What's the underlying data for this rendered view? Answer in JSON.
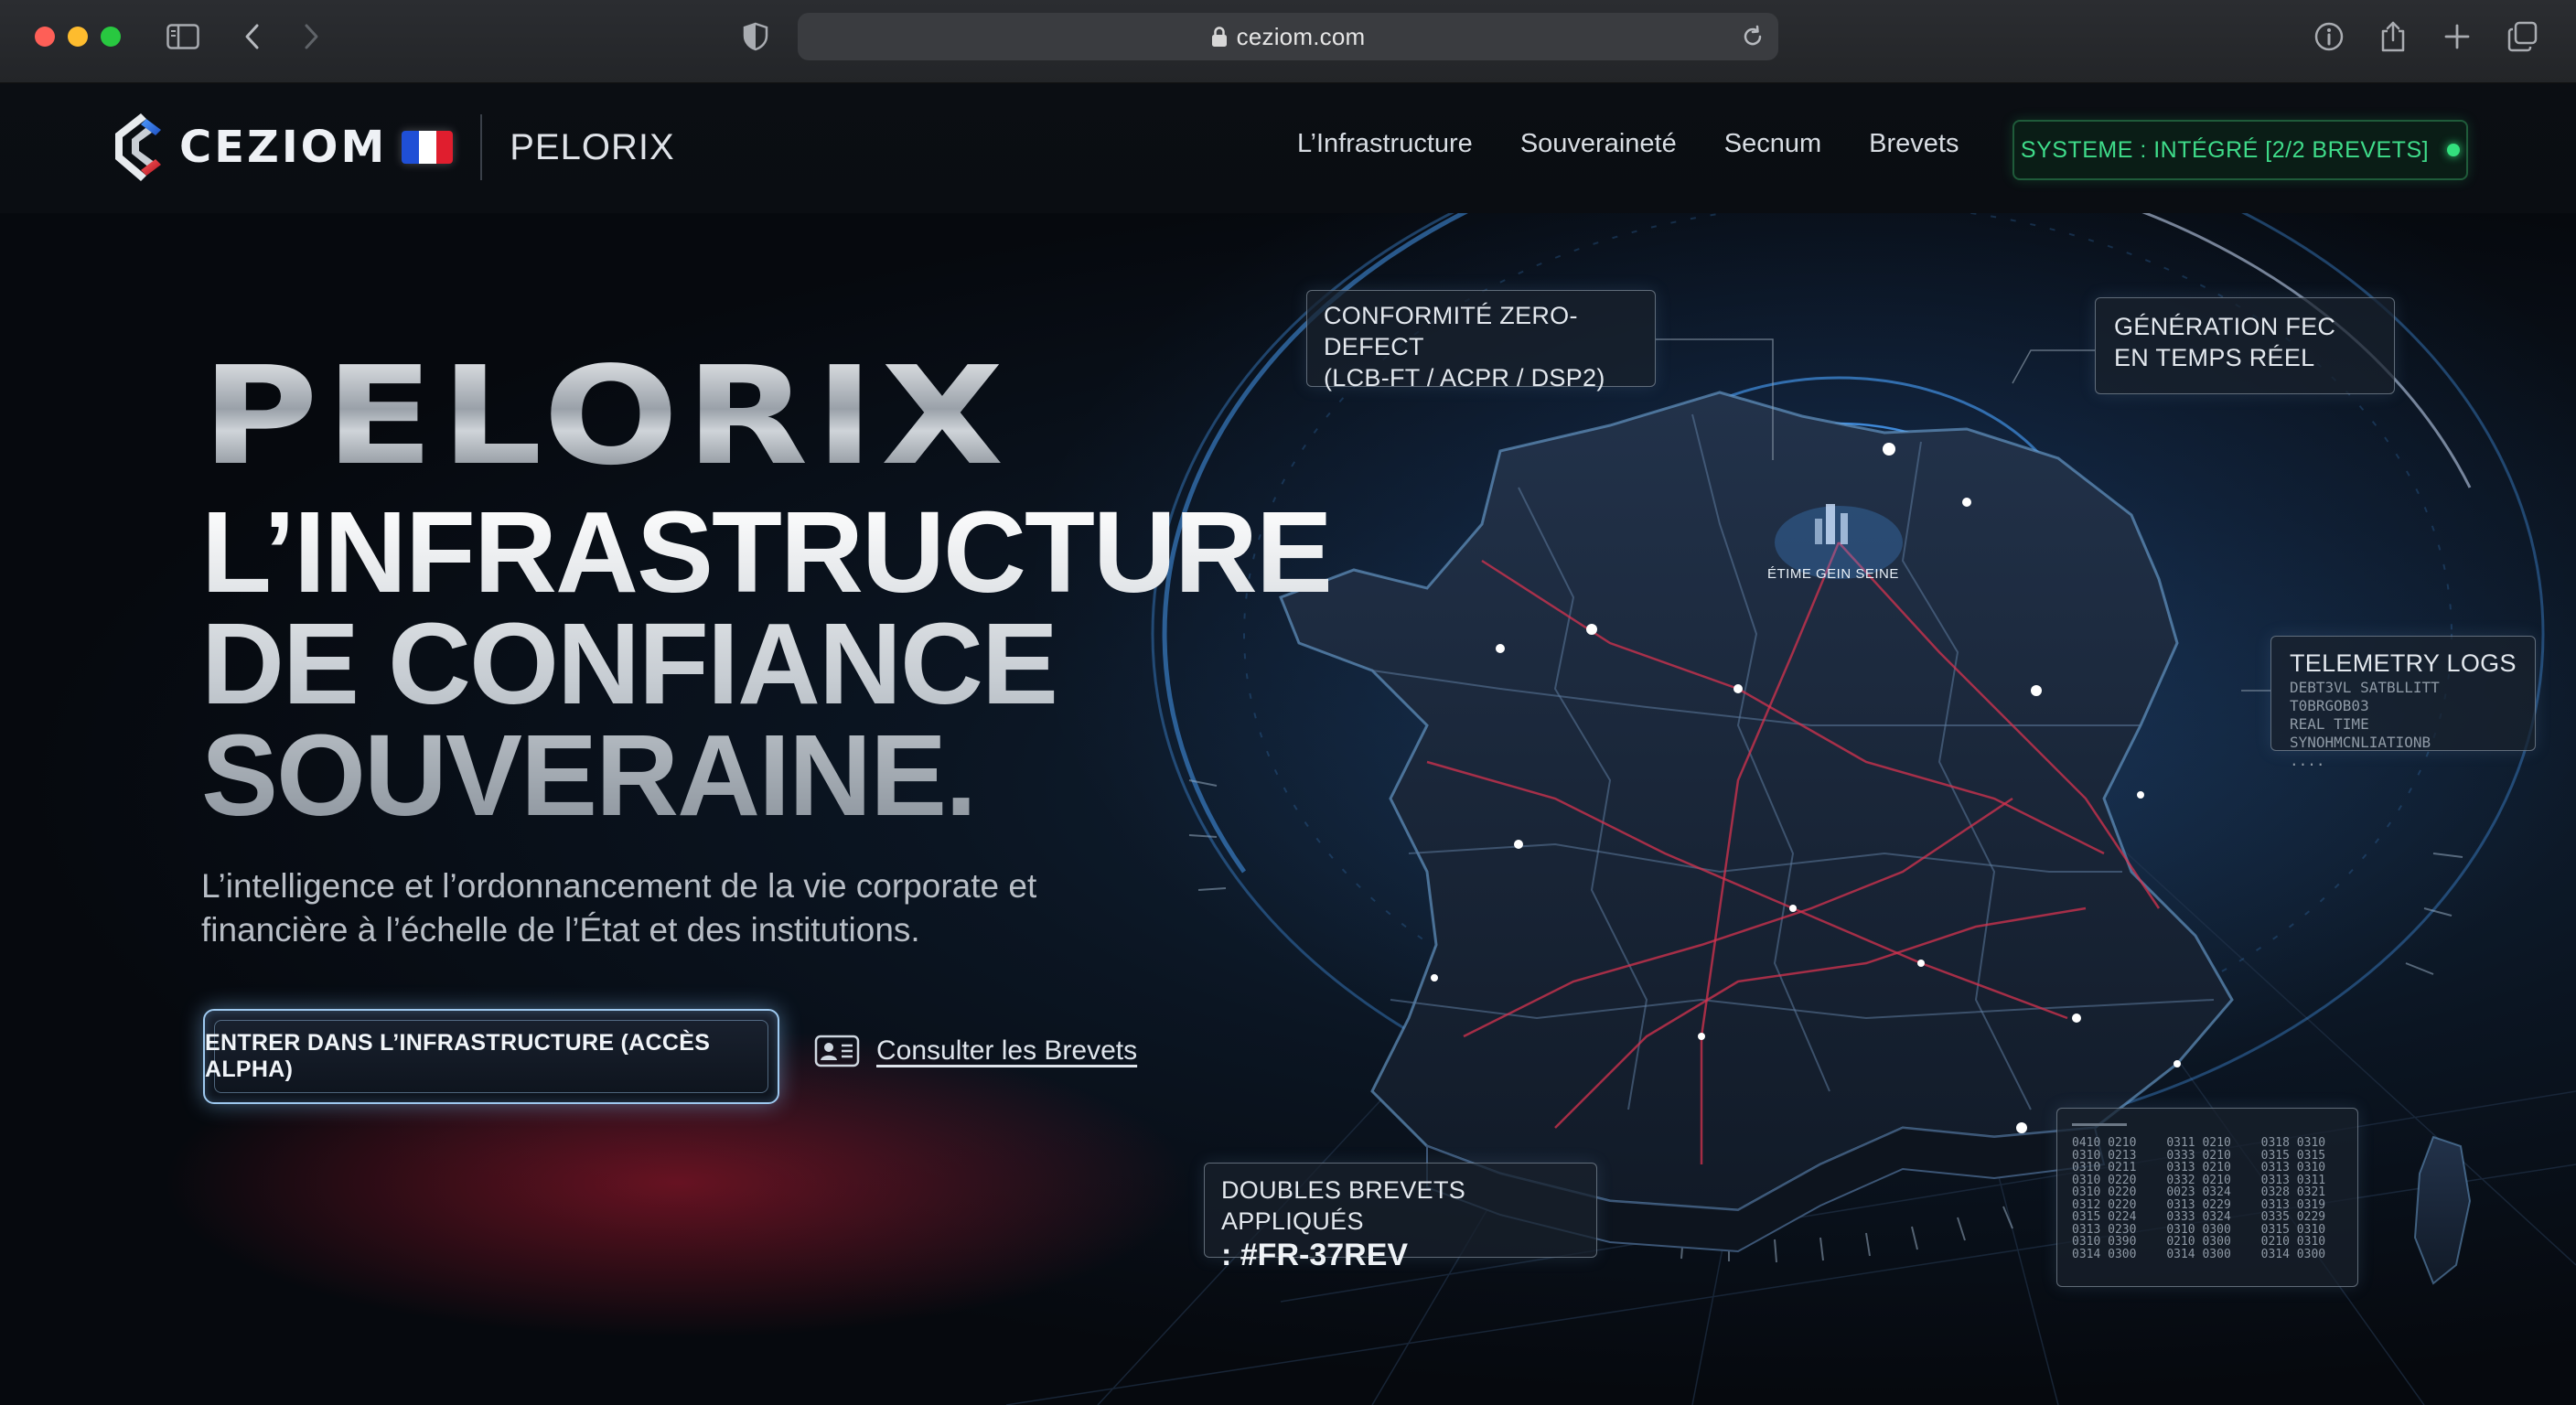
{
  "browser": {
    "url": "ceziom.com",
    "colors": {
      "close": "#fe5f57",
      "minimize": "#febc2e",
      "zoom": "#28c840"
    },
    "icons": [
      "sidebar-icon",
      "back-icon",
      "forward-icon",
      "shield-icon",
      "lock-icon",
      "reload-icon",
      "info-icon",
      "share-icon",
      "new-tab-icon",
      "tabs-overview-icon"
    ]
  },
  "header": {
    "brand": "CEZIOM",
    "product": "PELORIX",
    "nav": [
      {
        "label": "L’Infrastructure"
      },
      {
        "label": "Souveraineté"
      },
      {
        "label": "Secnum"
      },
      {
        "label": "Brevets"
      }
    ],
    "status": {
      "label": "SYSTEME : INTÉGRÉ [2/2 BREVETS]",
      "color": "#3fdc8a"
    },
    "flag_colors": [
      "#1f4fd6",
      "#ffffff",
      "#e01e2e"
    ]
  },
  "hero": {
    "big_title": "PELORIX",
    "headline": [
      "L’INFRASTRUCTURE",
      "DE CONFIANCE",
      "SOUVERAINE."
    ],
    "subtitle": "L’intelligence et l’ordonnancement de la vie corporate et financière à l’échelle de l’État et des institutions.",
    "cta_label": "ENTRER DANS L’INFRASTRUCTURE (ACCÈS ALPHA)",
    "secondary_label": "Consulter les Brevets"
  },
  "panels": {
    "compliance": {
      "line1": "CONFORMITÉ ZERO-DEFECT",
      "line2": "(LCB-FT / ACPR / DSP2)"
    },
    "fec": {
      "line1": "GÉNÉRATION FEC",
      "line2": "EN TEMPS RÉEL"
    },
    "telemetry": {
      "title": "TELEMETRY LOGS",
      "line1": "DEBT3VL SATBLLITT T0BRGOB03",
      "line2": "REAL TIME SYNOHMCNLIATIONB",
      "line3": "...."
    },
    "patents": {
      "line1": "DOUBLES BREVETS APPLIQUÉS",
      "line2": ": #FR-37REV"
    },
    "hex_codes": [
      "0410 0210",
      "0311 0210",
      "0318 0310",
      "0310 0213",
      "0333 0210",
      "0315 0315",
      "0310 0211",
      "0313 0210",
      "0313 0310",
      "0310 0220",
      "0332 0210",
      "0313 0311",
      "0310 0220",
      "0023 0324",
      "0328 0321",
      "0312 0220",
      "0313 0229",
      "0313 0319",
      "0315 0224",
      "0333 0324",
      "0335 0229",
      "0313 0230",
      "0310 0300",
      "0315 0310",
      "0310 0390",
      "0210 0300",
      "0210 0310",
      "0314 0300",
      "0314 0300",
      "0314 0300"
    ]
  },
  "map": {
    "label": "ÉTIME GEIN SEINE",
    "accent": "#4aa3ff",
    "network": "#d6334f"
  }
}
